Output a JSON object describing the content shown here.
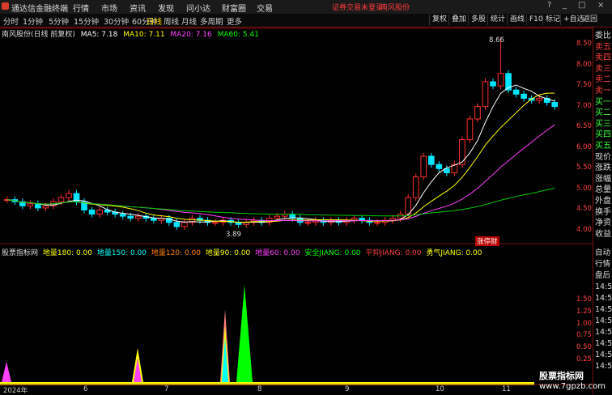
{
  "app": {
    "title": "通达信金融终端",
    "notice": "证券交易未登录",
    "stock_link": "南风股份"
  },
  "menu": [
    "行情",
    "市场",
    "资讯",
    "发现",
    "问小达",
    "财富圈",
    "交易"
  ],
  "periods": [
    "分时",
    "1分钟",
    "5分钟",
    "15分钟",
    "30分钟",
    "60分钟",
    "日线",
    "周线",
    "月线",
    "多周期",
    "更多"
  ],
  "active_period": "日线",
  "right_tools": [
    "复权",
    "叠加",
    "多股",
    "统计",
    "画线",
    "F10",
    "标记",
    "+自选",
    "返回"
  ],
  "upper_legend": {
    "name": "南风股份(日线 前复权)",
    "ma5": "MA5: 7.18",
    "ma10": "MA10: 7.11",
    "ma20": "MA20: 7.16",
    "ma60": "MA60: 5.41"
  },
  "lower_legend": {
    "name": "股票指标网",
    "items": [
      "地量180: 0.00",
      "地量150: 0.00",
      "地量120: 0.00",
      "地量90: 0.00",
      "地量60: 0.00",
      "安全JIANG: 0.00",
      "平抑JIANG: 0.00",
      "勇气JIANG: 0.00"
    ]
  },
  "price_axis": [
    "8.50",
    "8.00",
    "7.50",
    "7.00",
    "6.50",
    "6.00",
    "5.50",
    "5.00",
    "4.50",
    "4.00"
  ],
  "indicator_axis": [
    "1.50",
    "1.25",
    "1.00",
    "0.75",
    "0.50",
    "0.25"
  ],
  "annotations": {
    "high": "8.66",
    "low": "3.89",
    "tag": "涨停财"
  },
  "dates": [
    "2024年",
    "6",
    "7",
    "8",
    "9",
    "10",
    "11"
  ],
  "right_panel": [
    "委比",
    "卖五",
    "卖四",
    "卖三",
    "卖二",
    "卖一",
    "买一",
    "买二",
    "买三",
    "买四",
    "买五",
    "现价",
    "涨跌",
    "涨幅",
    "总量",
    "外盘",
    "换手",
    "净资",
    "收益"
  ],
  "right_panel2": [
    "自动",
    "行情",
    "盘后",
    "14:50",
    "14:50",
    "14:50",
    "14:50",
    "14:50",
    "14:50",
    "14:50",
    "14:50"
  ],
  "watermark": {
    "line1": "股票指标网",
    "line2": "www.7gpzb.com"
  },
  "window_buttons": [
    "?",
    "_",
    "□",
    "×"
  ],
  "chart_data": {
    "type": "candlestick",
    "series_daily_close": [
      4.75,
      4.7,
      4.6,
      4.65,
      4.55,
      4.6,
      4.7,
      4.8,
      4.9,
      4.7,
      4.5,
      4.4,
      4.5,
      4.45,
      4.4,
      4.35,
      4.3,
      4.35,
      4.3,
      4.25,
      4.3,
      4.2,
      4.1,
      4.2,
      4.3,
      4.25,
      4.2,
      4.2,
      4.25,
      4.2,
      4.15,
      4.2,
      4.25,
      4.2,
      4.3,
      4.35,
      4.4,
      4.3,
      4.2,
      4.2,
      4.25,
      4.2,
      4.25,
      4.2,
      4.25,
      4.3,
      4.25,
      4.2,
      4.2,
      4.25,
      4.3,
      4.4,
      4.8,
      5.3,
      5.8,
      5.6,
      5.5,
      5.4,
      5.6,
      6.2,
      6.7,
      7.0,
      7.6,
      7.5,
      7.8,
      7.4,
      7.3,
      7.2,
      7.15,
      7.2,
      7.1,
      7.0
    ],
    "ylim": [
      3.8,
      8.8
    ]
  }
}
